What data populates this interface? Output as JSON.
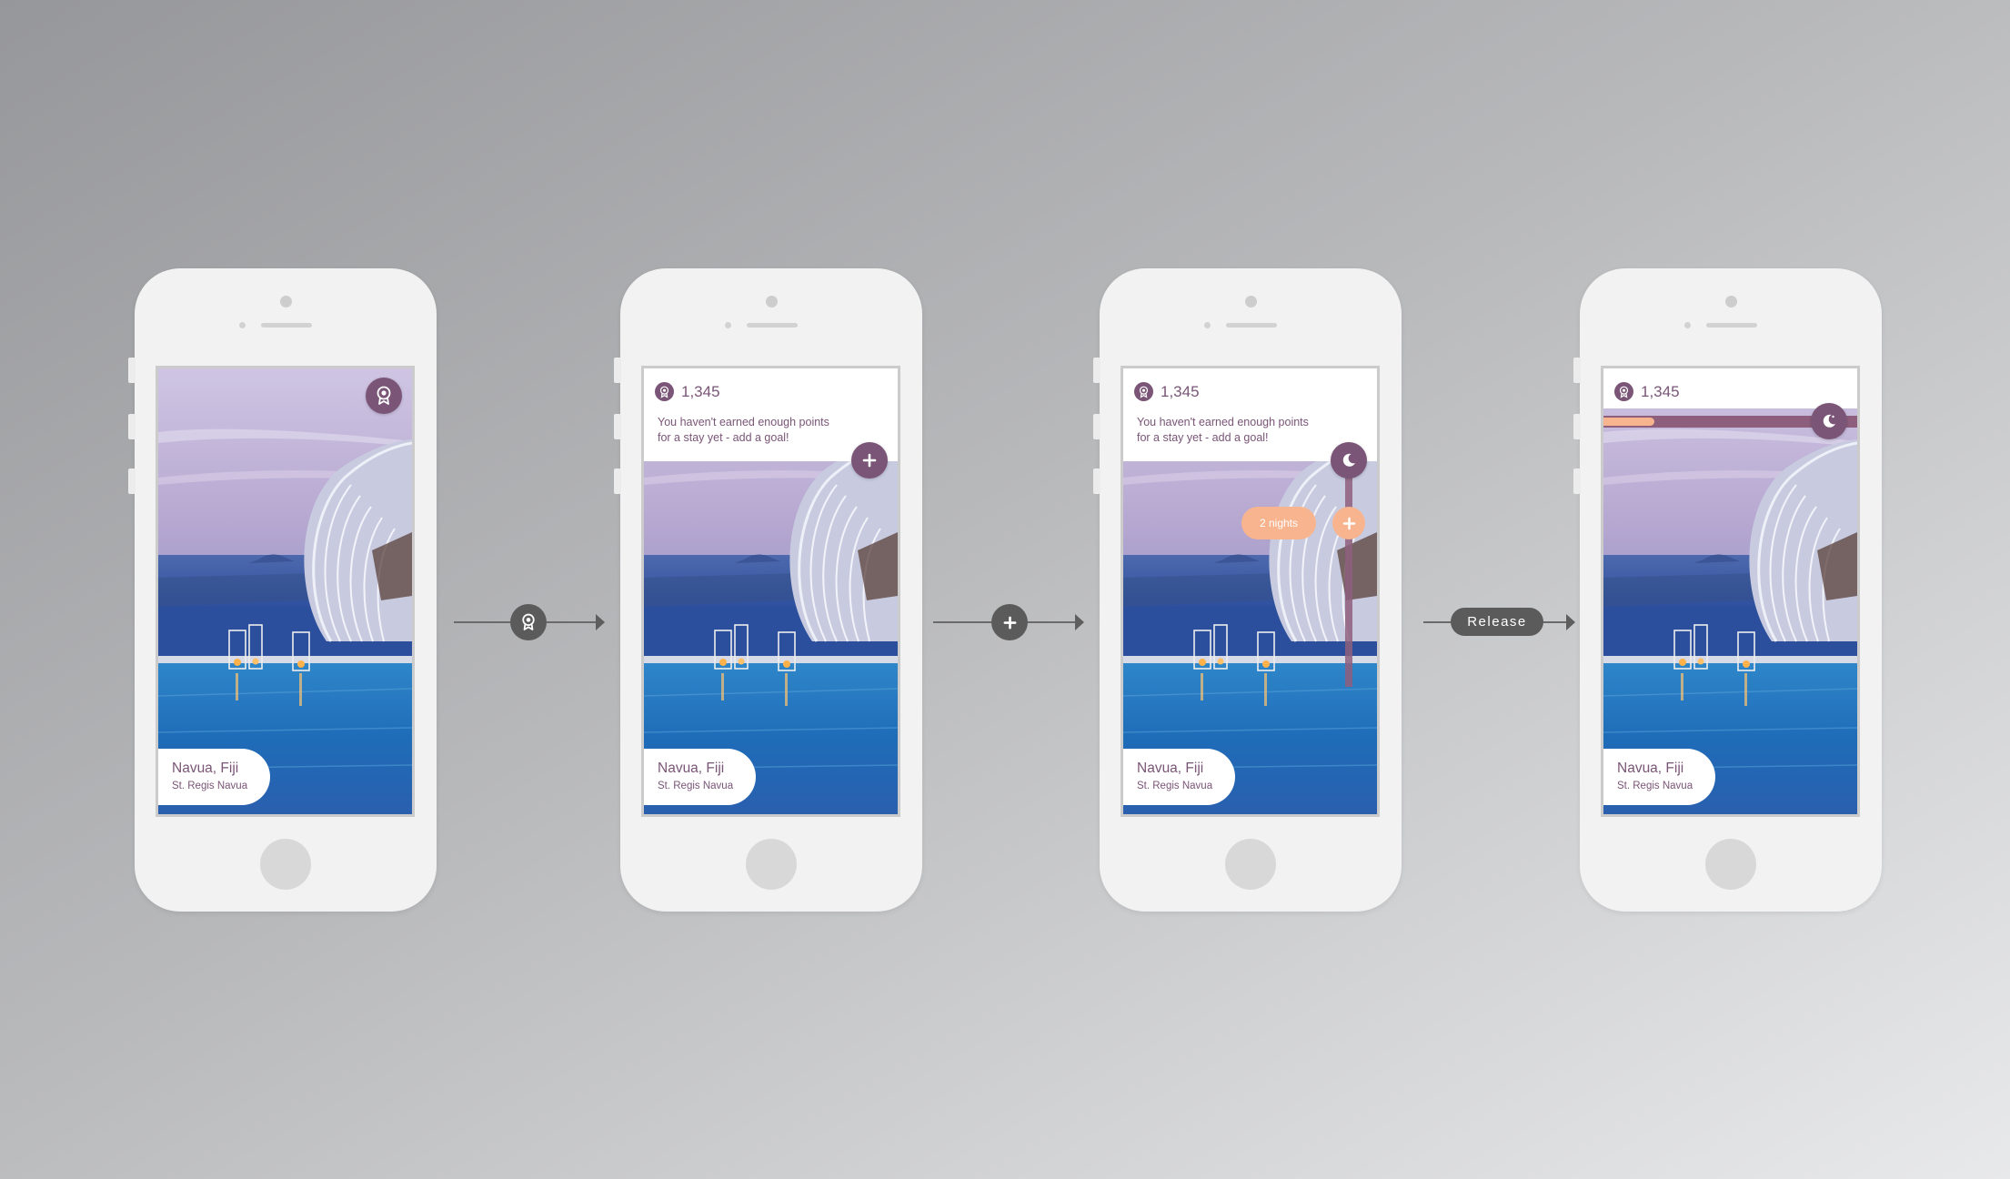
{
  "colors": {
    "accent_purple": "#7a5577",
    "peach": "#f7b48e",
    "connector_gray": "#5b5b5b",
    "phone_body": "#f2f2f2"
  },
  "icons": {
    "points": "award-ribbon-icon",
    "add": "plus-icon",
    "goal": "moon-icon"
  },
  "screens": [
    {
      "location_city": "Navua, Fiji",
      "location_hotel": "St. Regis Navua"
    },
    {
      "points": "1,345",
      "message_line1": "You haven't earned enough points",
      "message_line2": "for a stay yet - add a goal!",
      "location_city": "Navua, Fiji",
      "location_hotel": "St. Regis Navua"
    },
    {
      "points": "1,345",
      "message_line1": "You haven't earned enough points",
      "message_line2": "for a stay yet - add a goal!",
      "nights_label": "2 nights",
      "location_city": "Navua, Fiji",
      "location_hotel": "St. Regis Navua"
    },
    {
      "points": "1,345",
      "goal_progress": 0.2,
      "location_city": "Navua, Fiji",
      "location_hotel": "St. Regis Navua"
    }
  ],
  "transitions": [
    {
      "icon": "award-ribbon-icon"
    },
    {
      "icon": "plus-icon"
    },
    {
      "label": "Release"
    }
  ]
}
